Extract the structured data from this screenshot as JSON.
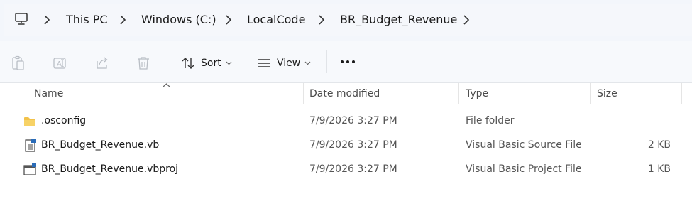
{
  "breadcrumb": {
    "items": [
      "This PC",
      "Windows (C:)",
      "LocalCode",
      "BR_Budget_Revenue"
    ]
  },
  "toolbar": {
    "sort_label": "Sort",
    "view_label": "View",
    "more_label": "..."
  },
  "file_list": {
    "columns": {
      "name": "Name",
      "date_modified": "Date modified",
      "type": "Type",
      "size": "Size"
    },
    "sort": {
      "column": "Name",
      "direction": "ascending"
    },
    "rows": [
      {
        "icon": "folder-icon",
        "name": ".osconfig",
        "date": "7/9/2026 3:27 PM",
        "type": "File folder",
        "size": ""
      },
      {
        "icon": "vb-source-file-icon",
        "name": "BR_Budget_Revenue.vb",
        "date": "7/9/2026 3:27 PM",
        "type": "Visual Basic Source File",
        "size": "2 KB"
      },
      {
        "icon": "vb-project-file-icon",
        "name": "BR_Budget_Revenue.vbproj",
        "date": "7/9/2026 3:27 PM",
        "type": "Visual Basic Project File",
        "size": "1 KB"
      }
    ]
  },
  "colors": {
    "folder": "#f2c24a",
    "address_bg": "#f3f6fb",
    "command_bg": "#f7f9fc",
    "disabled_icon": "#b9bec5"
  }
}
